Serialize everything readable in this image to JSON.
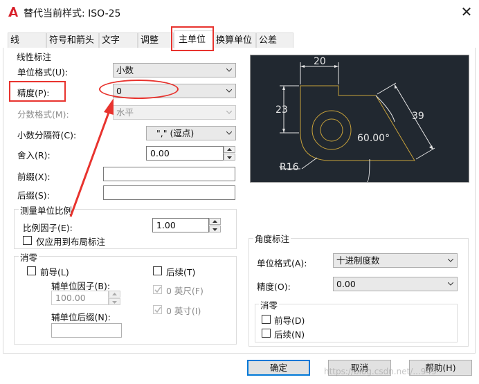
{
  "window": {
    "title": "替代当前样式: ISO-25",
    "close_label": "✕"
  },
  "tabs": [
    "线",
    "符号和箭头",
    "文字",
    "调整",
    "主单位",
    "换算单位",
    "公差"
  ],
  "linear": {
    "group_title": "线性标注",
    "unit_format_label": "单位格式(U):",
    "unit_format_value": "小数",
    "precision_label": "精度(P):",
    "precision_value": "0",
    "fraction_label": "分数格式(M):",
    "fraction_value": "水平",
    "decimal_sep_label": "小数分隔符(C):",
    "decimal_sep_value": "\",\"  (逗点)",
    "round_label": "舍入(R):",
    "round_value": "0.00",
    "prefix_label": "前缀(X):",
    "prefix_value": "",
    "suffix_label": "后缀(S):",
    "suffix_value": ""
  },
  "scale": {
    "group_title": "测量单位比例",
    "factor_label": "比例因子(E):",
    "factor_value": "1.00",
    "layout_only_label": "仅应用到布局标注"
  },
  "zero_suppress": {
    "group_title": "消零",
    "leading_label": "前导(L)",
    "sub_factor_label": "辅单位因子(B):",
    "sub_factor_value": "100.00",
    "sub_suffix_label": "辅单位后缀(N):",
    "sub_suffix_value": "",
    "trailing_label": "后续(T)",
    "feet_label": "0 英尺(F)",
    "inches_label": "0 英寸(I)"
  },
  "angular": {
    "group_title": "角度标注",
    "unit_format_label": "单位格式(A):",
    "unit_format_value": "十进制度数",
    "precision_label": "精度(O):",
    "precision_value": "0.00",
    "zero_title": "消零",
    "leading_label": "前导(D)",
    "trailing_label": "后续(N)"
  },
  "preview": {
    "dim_top": "20",
    "dim_left": "23",
    "dim_right": "39",
    "angle": "60.00°",
    "radius": "R16"
  },
  "buttons": {
    "ok": "确定",
    "cancel": "取消",
    "help": "帮助(H)"
  },
  "watermark": "https://blog.csdn.net/...949",
  "colors": {
    "annotation_red": "#e8332e",
    "preview_bg": "#212830",
    "geometry": "#c8a23a",
    "focus_blue": "#0078d7"
  }
}
